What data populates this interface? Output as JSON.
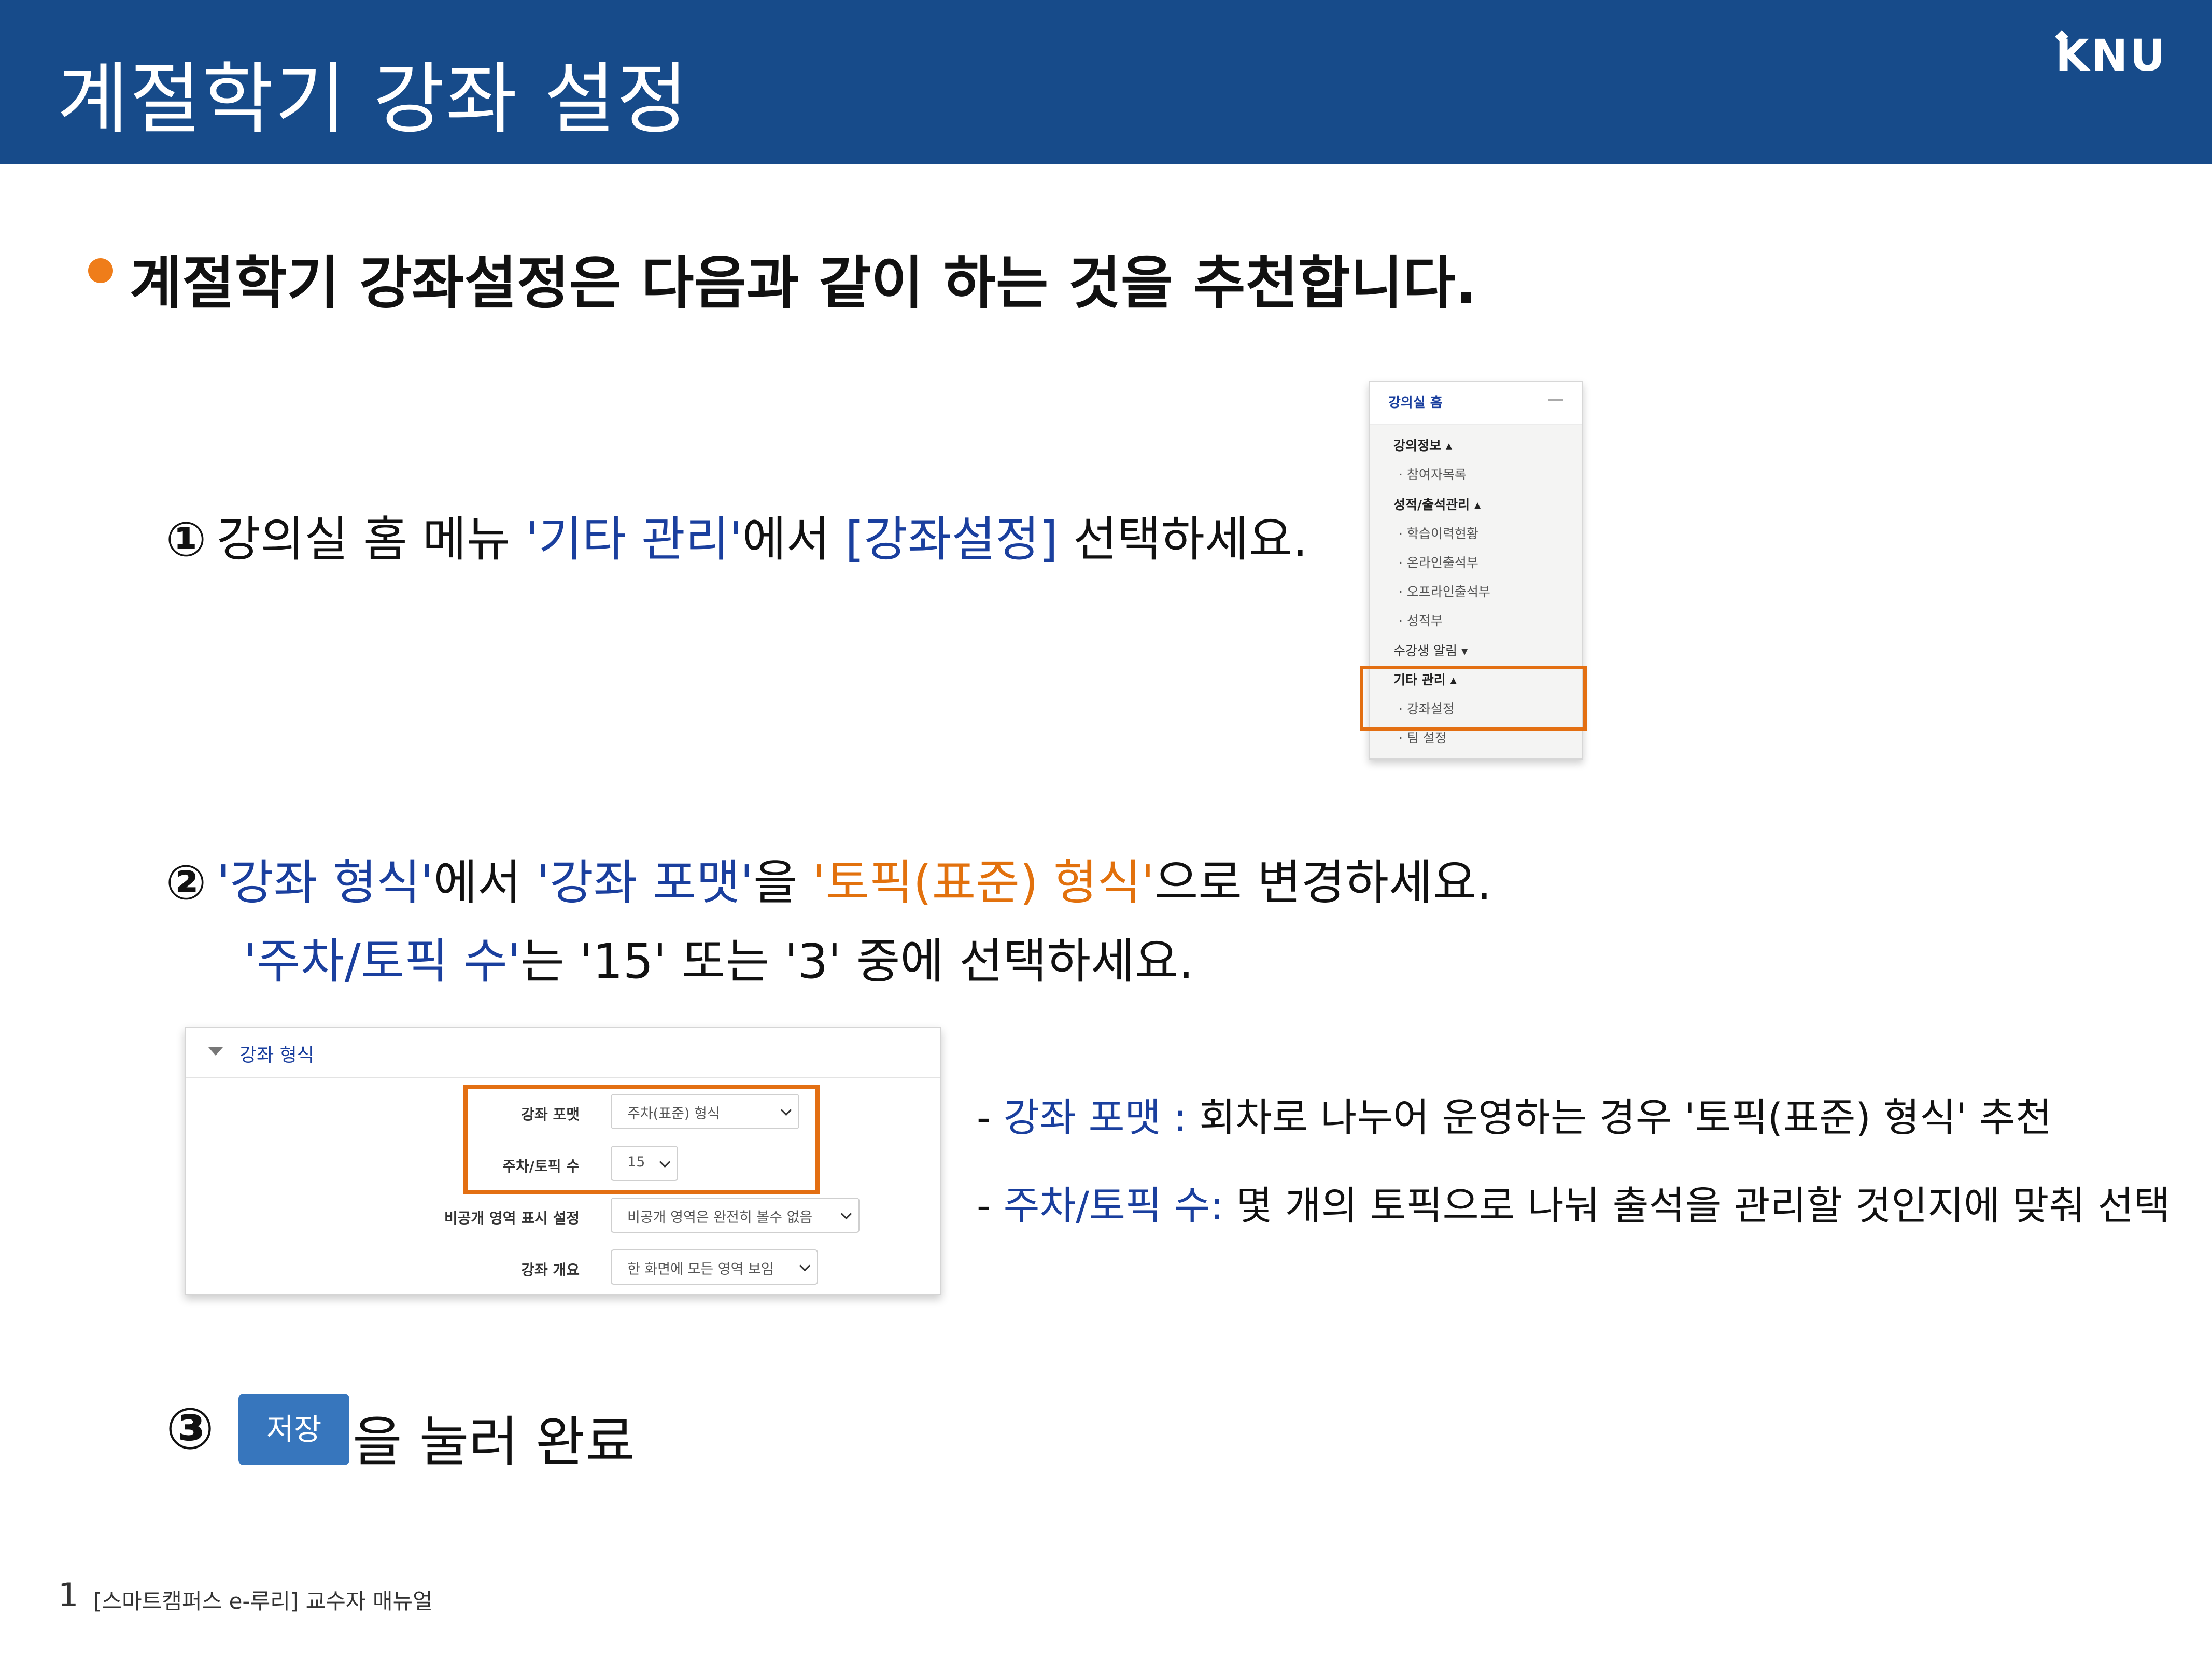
{
  "header": {
    "title": "계절학기 강좌 설정",
    "logo": "KNU",
    "background": "#174b8a"
  },
  "headline": "계절학기 강좌설정은 다음과 같이 하는 것을 추천합니다.",
  "step1": {
    "num": "①",
    "text_a": "강의실 홈 메뉴 ",
    "text_b": "'기타 관리'",
    "text_c": "에서 ",
    "text_d": "[강좌설정]",
    "text_e": " 선택하세요."
  },
  "sidebar": {
    "home": "강의실 홈",
    "items": [
      {
        "label": "강의정보 ▴"
      },
      {
        "label": "· 참여자목록"
      },
      {
        "label": "성적/출석관리 ▴"
      },
      {
        "label": "· 학습이력현황"
      },
      {
        "label": "· 온라인출석부"
      },
      {
        "label": "· 오프라인출석부"
      },
      {
        "label": "· 성적부"
      },
      {
        "label": "수강생 알림 ▾"
      },
      {
        "label": "기타 관리 ▴"
      },
      {
        "label": "· 강좌설정"
      },
      {
        "label": "· 팀 설정"
      }
    ]
  },
  "step2": {
    "num": "②",
    "p1": "'강좌 형식'",
    "p2": "에서 ",
    "p3": "'강좌 포맷'",
    "p4": "을 ",
    "p5": "'토픽(표준) 형식'",
    "p6": "으로 변경하세요.",
    "l2a": "'주차/토픽 수'",
    "l2b": "는 '15' 또는 '3' 중에 선택하세요."
  },
  "panel": {
    "title": "강좌 형식",
    "rows": [
      {
        "label": "강좌 포맷",
        "value": "주차(표준) 형식"
      },
      {
        "label": "주차/토픽 수",
        "value": "15"
      },
      {
        "label": "비공개 영역 표시 설정",
        "value": "비공개 영역은 완전히 볼수 없음"
      },
      {
        "label": "강좌 개요",
        "value": "한 화면에 모든 영역 보임"
      }
    ]
  },
  "notes": [
    {
      "dash": "- ",
      "key": "강좌 포맷 :",
      "text": " 회차로 나누어 운영하는 경우 '토픽(표준) 형식' 추천"
    },
    {
      "dash": "- ",
      "key": "주차/토픽 수:",
      "text": " 몇 개의 토픽으로 나눠 출석을 관리할 것인지에 맞춰 선택"
    }
  ],
  "step3": {
    "num": "③",
    "button": "저장",
    "text": "을  눌러 완료"
  },
  "footer": {
    "page": "1",
    "text": "[스마트캠퍼스 e-루리]  교수자 매뉴얼"
  },
  "colors": {
    "accent_blue": "#1a3f9e",
    "accent_orange": "#e2710d",
    "bullet": "#ef7d1a",
    "button": "#3776bd"
  }
}
